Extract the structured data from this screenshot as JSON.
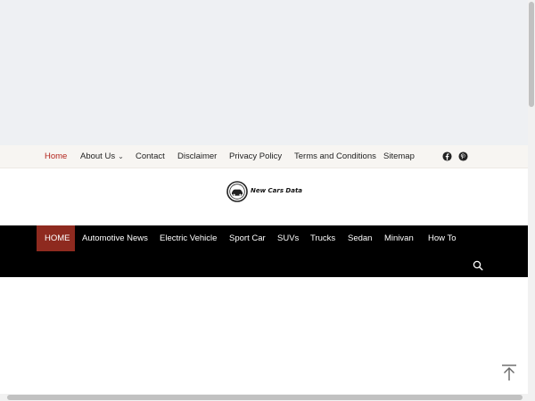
{
  "topnav": {
    "items": [
      "Home",
      "About Us",
      "Contact",
      "Disclaimer",
      "Privacy Policy",
      "Terms and Conditions",
      "Sitemap"
    ],
    "active_color": "#b3261e"
  },
  "social": [
    "facebook-icon",
    "pinterest-icon"
  ],
  "logo": {
    "text": "New Cars Data"
  },
  "mainnav": {
    "items": [
      "HOME",
      "Automotive News",
      "Electric Vehicle",
      "Sport Car",
      "SUVs",
      "Trucks",
      "Sedan",
      "Minivan",
      "How To"
    ],
    "active_bg": "#8e2a1f",
    "bg": "#000000"
  },
  "icons": {
    "search": "search-icon",
    "back_to_top": "arrow-up-icon"
  }
}
